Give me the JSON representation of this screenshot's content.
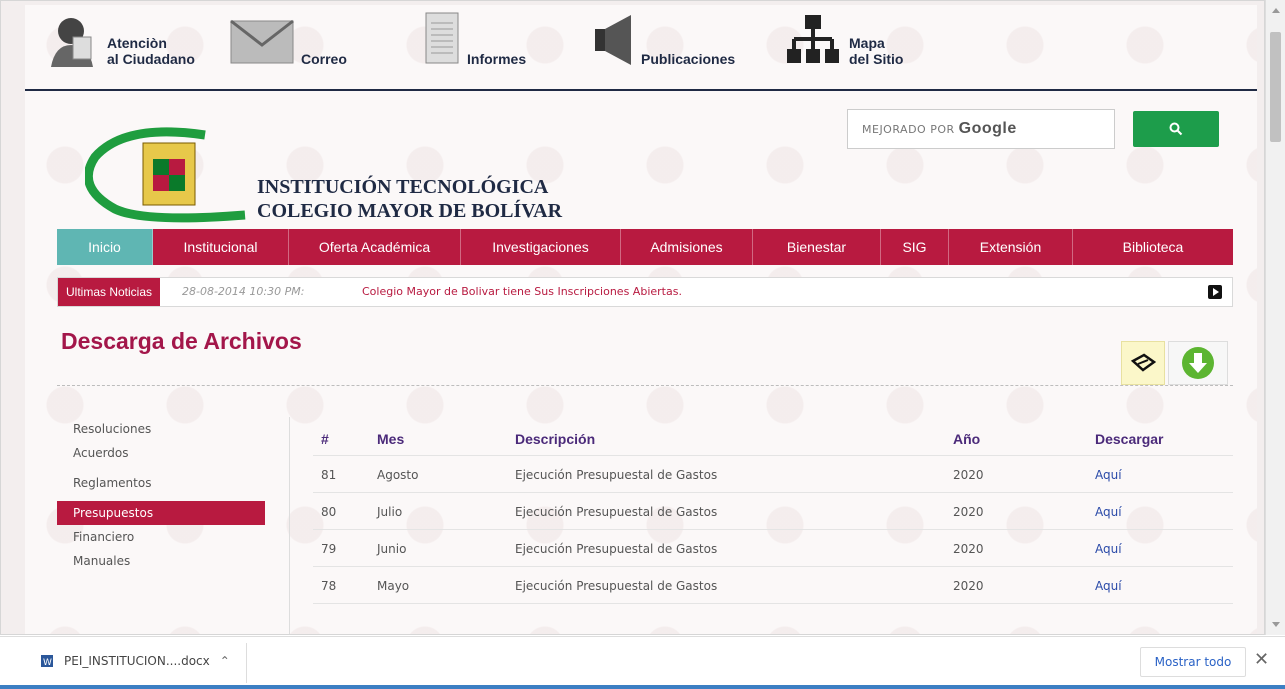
{
  "topbar": {
    "items": [
      {
        "line1": "Atenciòn",
        "line2": "al Ciudadano",
        "icon": "person-icon"
      },
      {
        "line1": "",
        "line2": "Correo",
        "icon": "envelope-icon"
      },
      {
        "line1": "",
        "line2": "Informes",
        "icon": "document-icon"
      },
      {
        "line1": "",
        "line2": "Publicaciones",
        "icon": "megaphone-icon"
      },
      {
        "line1": "Mapa",
        "line2": "del Sitio",
        "icon": "sitemap-icon"
      }
    ]
  },
  "search": {
    "placeholder_prefix": "MEJORADO POR",
    "placeholder_brand": "Google",
    "button_icon": "search-icon"
  },
  "institution": {
    "line1": "INSTITUCIÓN TECNOLÓGICA",
    "line2": "COLEGIO MAYOR DE BOLÍVAR"
  },
  "nav": {
    "items": [
      {
        "label": "Inicio",
        "active": true
      },
      {
        "label": "Institucional"
      },
      {
        "label": "Oferta Académica"
      },
      {
        "label": "Investigaciones"
      },
      {
        "label": "Admisiones"
      },
      {
        "label": "Bienestar"
      },
      {
        "label": "SIG"
      },
      {
        "label": "Extensión"
      },
      {
        "label": "Biblioteca"
      }
    ]
  },
  "ticker": {
    "tag": "Ultimas Noticias",
    "date": "28-08-2014 10:30 PM:",
    "text": "Colegio Mayor de Bolivar tiene Sus Inscripciones Abiertas."
  },
  "page_title": "Descarga de Archivos",
  "sidebar": {
    "items": [
      {
        "label": "Resoluciones"
      },
      {
        "label": "Acuerdos"
      },
      {
        "label": "Reglamentos"
      },
      {
        "label": "Presupuestos",
        "active": true
      },
      {
        "label": "Financiero"
      },
      {
        "label": "Manuales"
      }
    ]
  },
  "table": {
    "headers": {
      "num": "#",
      "mes": "Mes",
      "desc": "Descripción",
      "anio": "Año",
      "descargar": "Descargar"
    },
    "rows": [
      {
        "num": "81",
        "mes": "Agosto",
        "desc": "Ejecución Presupuestal de Gastos",
        "anio": "2020",
        "link": "Aquí"
      },
      {
        "num": "80",
        "mes": "Julio",
        "desc": "Ejecución Presupuestal de Gastos",
        "anio": "2020",
        "link": "Aquí"
      },
      {
        "num": "79",
        "mes": "Junio",
        "desc": "Ejecución Presupuestal de Gastos",
        "anio": "2020",
        "link": "Aquí"
      },
      {
        "num": "78",
        "mes": "Mayo",
        "desc": "Ejecución Presupuestal de Gastos",
        "anio": "2020",
        "link": "Aquí"
      }
    ]
  },
  "downloads": {
    "filename": "PEI_INSTITUCION....docx",
    "show_all": "Mostrar todo",
    "close": "✕"
  },
  "colors": {
    "brand_red": "#b81a40",
    "active_teal": "#5fb6b3",
    "title": "#a3164a",
    "search_green": "#1d9d4b"
  }
}
